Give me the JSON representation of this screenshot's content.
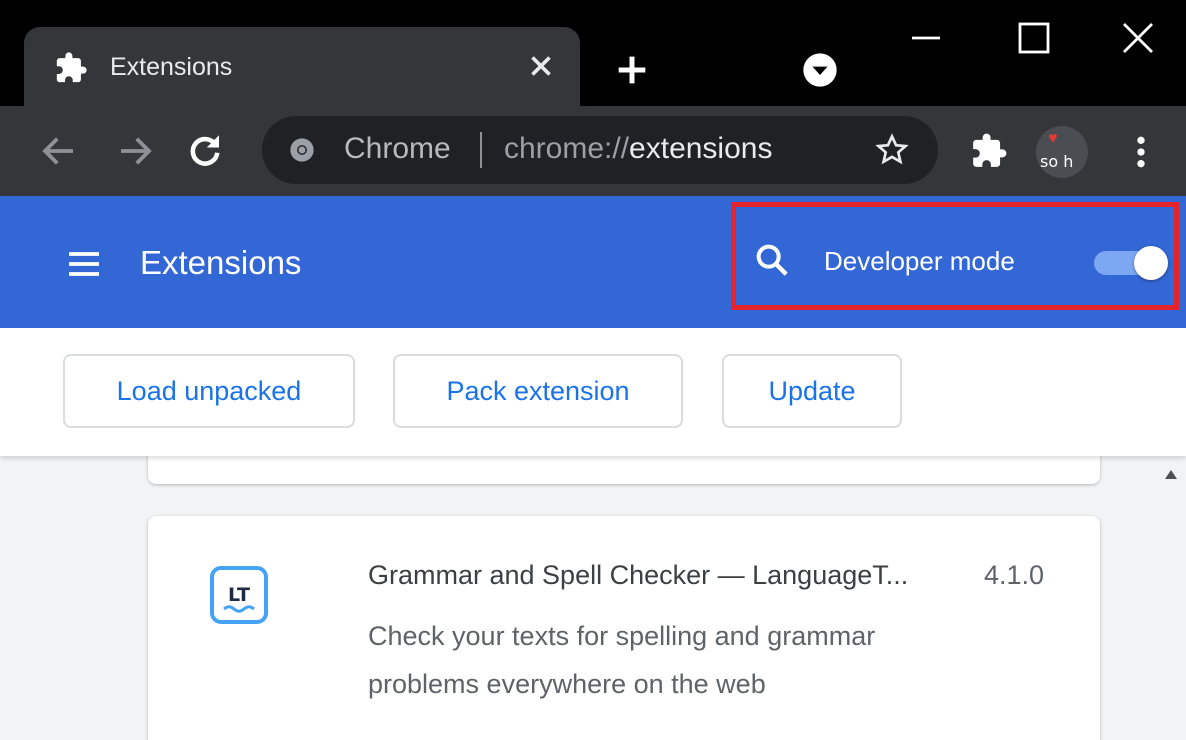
{
  "browser": {
    "tab_title": "Extensions",
    "omnibox": {
      "chip": "Chrome",
      "url_prefix": "chrome://",
      "url_host": "extensions"
    },
    "avatar_text": "so h"
  },
  "header": {
    "title": "Extensions",
    "developer_mode_label": "Developer mode",
    "developer_mode_on": true,
    "accent_color": "#3367d6",
    "highlight_color": "#e3242b"
  },
  "dev_toolbar": {
    "load_unpacked": "Load unpacked",
    "pack_extension": "Pack extension",
    "update": "Update"
  },
  "extension_card": {
    "icon_text": "LT",
    "name": "Grammar and Spell Checker — LanguageT...",
    "version": "4.1.0",
    "description_line1": "Check your texts for spelling and grammar",
    "description_line2": "problems everywhere on the web"
  },
  "icons": [
    "puzzle-icon",
    "close-icon",
    "plus-icon",
    "chevron-down-icon",
    "minimize-icon",
    "maximize-icon",
    "back-arrow-icon",
    "forward-arrow-icon",
    "reload-icon",
    "chrome-icon",
    "star-icon",
    "extensions-icon",
    "kebab-menu-icon",
    "hamburger-menu-icon",
    "search-icon",
    "scroll-up-icon"
  ]
}
